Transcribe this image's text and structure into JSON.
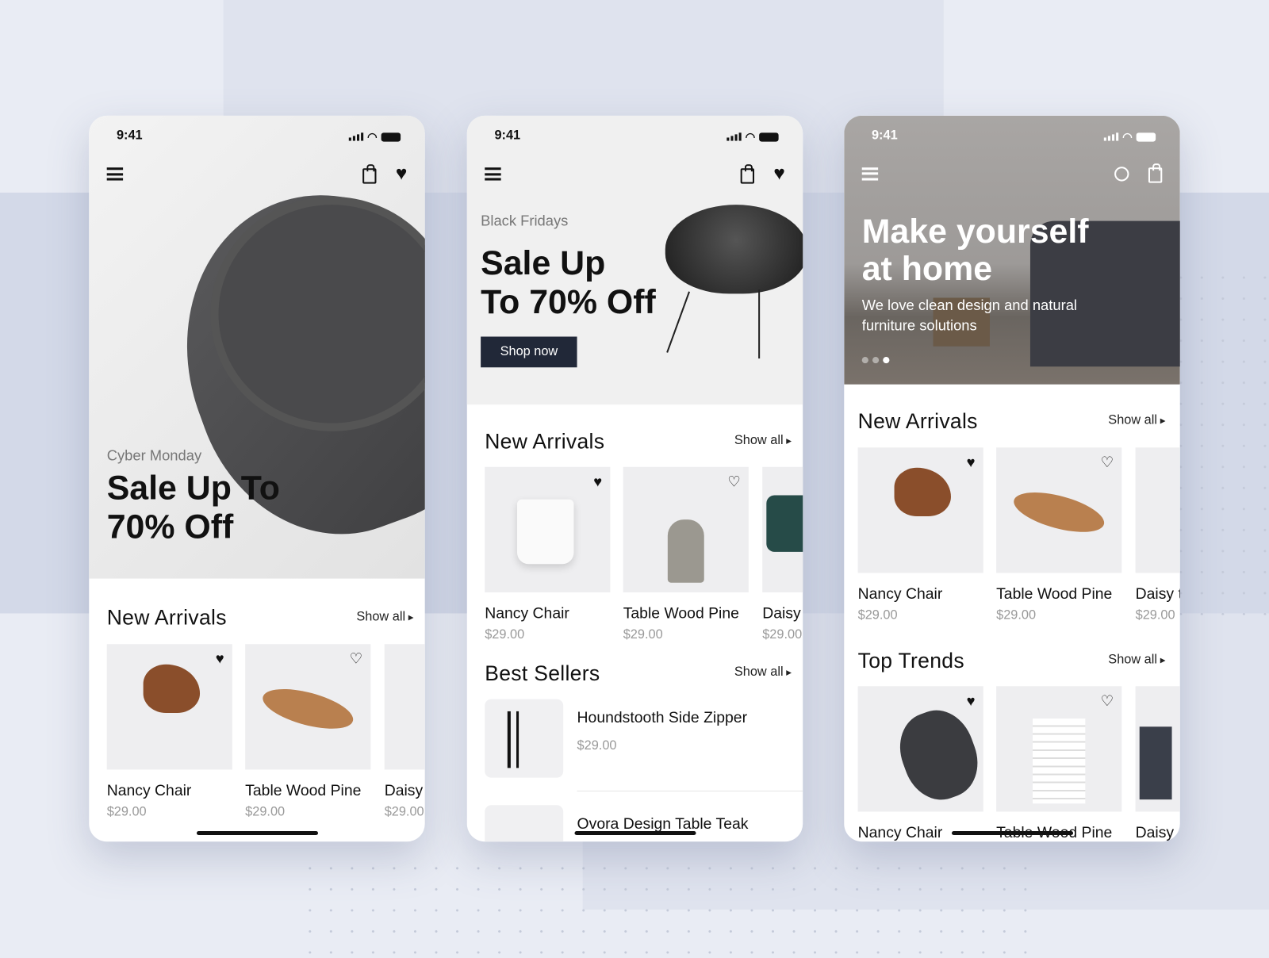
{
  "status": {
    "time": "9:41"
  },
  "phone1": {
    "hero_kicker": "Cyber Monday",
    "hero_title_line1": "Sale Up To",
    "hero_title_line2": "70% Off",
    "new_arrivals": {
      "title": "New Arrivals",
      "show_all": "Show all",
      "items": [
        {
          "name": "Nancy Chair",
          "price": "$29.00",
          "favorited": true
        },
        {
          "name": "Table Wood Pine",
          "price": "$29.00",
          "favorited": false
        },
        {
          "name": "Daisy",
          "price": "$29.00"
        }
      ]
    }
  },
  "phone2": {
    "hero_kicker": "Black Fridays",
    "hero_title_line1": "Sale Up",
    "hero_title_line2": "To 70% Off",
    "cta": "Shop now",
    "new_arrivals": {
      "title": "New Arrivals",
      "show_all": "Show all",
      "items": [
        {
          "name": "Nancy Chair",
          "price": "$29.00",
          "favorited": true
        },
        {
          "name": "Table Wood Pine",
          "price": "$29.00",
          "favorited": false
        },
        {
          "name": "Daisy",
          "price": "$29.00"
        }
      ]
    },
    "best_sellers": {
      "title": "Best Sellers",
      "show_all": "Show all",
      "items": [
        {
          "name": "Houndstooth Side Zipper",
          "price": "$29.00"
        },
        {
          "name": "Ovora Design Table Teak"
        }
      ]
    }
  },
  "phone3": {
    "hero_title_line1": "Make yourself",
    "hero_title_line2": "at home",
    "hero_subtitle_line1": "We love clean design and natural",
    "hero_subtitle_line2": "furniture solutions",
    "carousel": {
      "pages": 3,
      "active": 3
    },
    "new_arrivals": {
      "title": "New Arrivals",
      "show_all": "Show all",
      "items": [
        {
          "name": "Nancy Chair",
          "price": "$29.00",
          "favorited": true
        },
        {
          "name": "Table Wood Pine",
          "price": "$29.00",
          "favorited": false
        },
        {
          "name": "Daisy t",
          "price": "$29.00"
        }
      ]
    },
    "top_trends": {
      "title": "Top Trends",
      "show_all": "Show all",
      "items": [
        {
          "name": "Nancy Chair",
          "favorited": true
        },
        {
          "name": "Table Wood Pine",
          "favorited": false
        },
        {
          "name": "Daisy"
        }
      ]
    }
  },
  "colors": {
    "button": "#212838",
    "background": "#e9ecf4",
    "price": "#999999"
  }
}
